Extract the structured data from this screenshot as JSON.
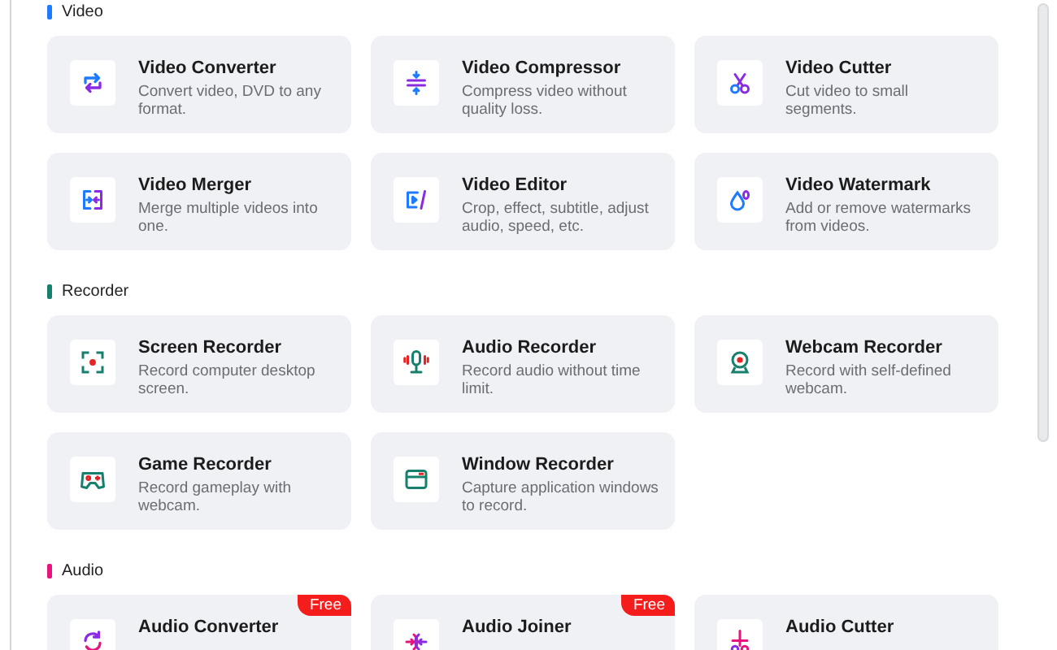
{
  "sections": [
    {
      "title": "Video",
      "color": "#1e7bff",
      "tools": [
        {
          "kind": "convert",
          "title": "Video Converter",
          "description": "Convert video, DVD to any format."
        },
        {
          "kind": "compress",
          "title": "Video Compressor",
          "description": "Compress video without quality loss."
        },
        {
          "kind": "cut",
          "title": "Video Cutter",
          "description": "Cut video to small segments."
        },
        {
          "kind": "merge",
          "title": "Video Merger",
          "description": "Merge multiple videos into one."
        },
        {
          "kind": "edit",
          "title": "Video Editor",
          "description": "Crop, effect, subtitle, adjust audio, speed, etc."
        },
        {
          "kind": "watermark",
          "title": "Video Watermark",
          "description": "Add or remove watermarks from videos."
        }
      ]
    },
    {
      "title": "Recorder",
      "color": "#17806d",
      "tools": [
        {
          "kind": "screen",
          "title": "Screen Recorder",
          "description": "Record computer desktop screen."
        },
        {
          "kind": "mic",
          "title": "Audio Recorder",
          "description": "Record audio without time limit."
        },
        {
          "kind": "webcam",
          "title": "Webcam Recorder",
          "description": "Record with self-defined webcam."
        },
        {
          "kind": "game",
          "title": "Game Recorder",
          "description": "Record gameplay with webcam."
        },
        {
          "kind": "window",
          "title": "Window Recorder",
          "description": "Capture application windows to record."
        }
      ]
    },
    {
      "title": "Audio",
      "color": "#e8137c",
      "tools": [
        {
          "kind": "audio-convert",
          "title": "Audio Converter",
          "badge": "Free"
        },
        {
          "kind": "audio-join",
          "title": "Audio Joiner",
          "badge": "Free"
        },
        {
          "kind": "audio-cut",
          "title": "Audio Cutter"
        }
      ]
    }
  ]
}
